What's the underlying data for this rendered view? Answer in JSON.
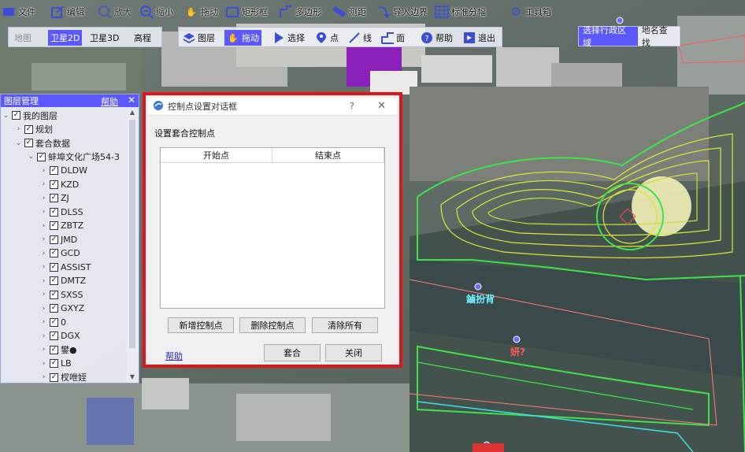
{
  "toolbar": {
    "items": [
      {
        "label": "文件",
        "icon": "file-icon"
      },
      {
        "label": "编辑",
        "icon": "edit-icon"
      },
      {
        "label": "放大",
        "icon": "zoom-in-icon"
      },
      {
        "label": "缩小",
        "icon": "zoom-out-icon"
      },
      {
        "label": "拖动",
        "icon": "hand-icon"
      },
      {
        "label": "矩形框",
        "icon": "rectangle-icon"
      },
      {
        "label": "多边形",
        "icon": "polygon-icon"
      },
      {
        "label": "测距",
        "icon": "ruler-icon"
      },
      {
        "label": "导入边界",
        "icon": "import-icon"
      },
      {
        "label": "标准分幅",
        "icon": "grid-icon"
      },
      {
        "label": "工具箱",
        "icon": "gear-icon"
      }
    ]
  },
  "view_modes": [
    {
      "label": "地图"
    },
    {
      "label": "卫星2D"
    },
    {
      "label": "卫星3D"
    },
    {
      "label": "高程"
    }
  ],
  "map_tools": [
    {
      "label": "图层",
      "icon": "layers-icon"
    },
    {
      "label": "拖动",
      "icon": "hand-icon"
    },
    {
      "label": "选择",
      "icon": "cursor-icon"
    },
    {
      "label": "点",
      "icon": "pin-icon"
    },
    {
      "label": "线",
      "icon": "line-icon"
    },
    {
      "label": "面",
      "icon": "area-icon"
    },
    {
      "label": "帮助",
      "icon": "help-icon"
    },
    {
      "label": "退出",
      "icon": "exit-icon"
    }
  ],
  "region_tabs": [
    {
      "label": "选择行政区域"
    },
    {
      "label": "地名查找"
    }
  ],
  "layer_panel": {
    "title": "图层管理",
    "help": "帮助",
    "nodes": [
      {
        "label": "我的图层",
        "level": 0,
        "expanded": true,
        "checked": true
      },
      {
        "label": "规划",
        "level": 1,
        "expanded": false,
        "checked": true
      },
      {
        "label": "套合数据",
        "level": 1,
        "expanded": true,
        "checked": true
      },
      {
        "label": "蚌埠文化广场54-3",
        "level": 2,
        "expanded": true,
        "checked": true
      },
      {
        "label": "DLDW",
        "level": 3,
        "expanded": false,
        "checked": true
      },
      {
        "label": "KZD",
        "level": 3,
        "expanded": false,
        "checked": true
      },
      {
        "label": "ZJ",
        "level": 3,
        "expanded": false,
        "checked": true
      },
      {
        "label": "DLSS",
        "level": 3,
        "expanded": false,
        "checked": true
      },
      {
        "label": "ZBTZ",
        "level": 3,
        "expanded": false,
        "checked": true
      },
      {
        "label": "JMD",
        "level": 3,
        "expanded": false,
        "checked": true
      },
      {
        "label": "GCD",
        "level": 3,
        "expanded": false,
        "checked": true
      },
      {
        "label": "ASSIST",
        "level": 3,
        "expanded": false,
        "checked": true
      },
      {
        "label": "DMTZ",
        "level": 3,
        "expanded": false,
        "checked": true
      },
      {
        "label": "SXSS",
        "level": 3,
        "expanded": false,
        "checked": true
      },
      {
        "label": "GXYZ",
        "level": 3,
        "expanded": false,
        "checked": true
      },
      {
        "label": "0",
        "level": 3,
        "expanded": false,
        "checked": true
      },
      {
        "label": "DGX",
        "level": 3,
        "expanded": false,
        "checked": true
      },
      {
        "label": "鐢●",
        "level": 3,
        "expanded": false,
        "checked": true
      },
      {
        "label": "LB",
        "level": 3,
        "expanded": false,
        "checked": true
      },
      {
        "label": "杈呭姪",
        "level": 3,
        "expanded": false,
        "checked": true
      }
    ]
  },
  "dialog": {
    "title": "控制点设置对话框",
    "help_mark": "?",
    "close_mark": "✕",
    "section_label": "设置套合控制点",
    "columns": [
      "开始点",
      "结束点"
    ],
    "rows": [],
    "buttons": {
      "add": "新增控制点",
      "delete": "删除控制点",
      "clear": "清除所有",
      "apply": "套合",
      "close": "关闭"
    },
    "help_link": "帮助"
  },
  "map_labels": [
    {
      "text": "鏀扮背",
      "color": "#6ff0ff"
    },
    {
      "text": "妍?",
      "color": "#ff5a5a"
    }
  ],
  "colors": {
    "accent": "#5b58ff",
    "dialog_border": "#e0151a",
    "contour_yellow": "#d8e83a",
    "contour_green": "#3fe24a"
  }
}
